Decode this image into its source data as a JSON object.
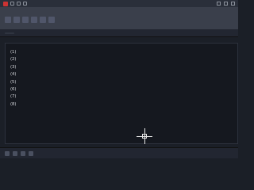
{
  "window": {
    "title": ""
  },
  "file_tab": {
    "label": ""
  },
  "document": {
    "intro": "",
    "items": [
      {
        "num": "(1)",
        "text": ""
      },
      {
        "num": "(2)",
        "text": ""
      },
      {
        "num": "(3)",
        "text": ""
      },
      {
        "num": "(4)",
        "text": ""
      },
      {
        "num": "(5)",
        "text": ""
      },
      {
        "num": "(6)",
        "text": ""
      },
      {
        "num": "(7)",
        "text": ""
      },
      {
        "num": "(8)",
        "text": ""
      }
    ]
  }
}
